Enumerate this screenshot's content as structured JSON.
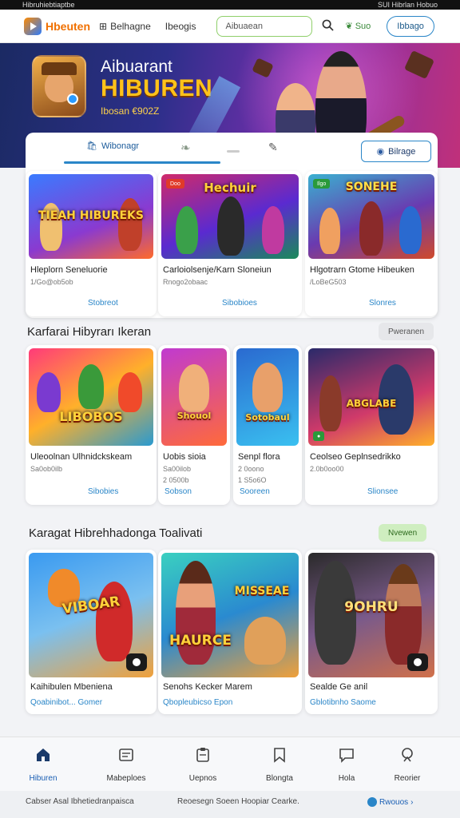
{
  "status_bar": {
    "left": "Hibruhiebtiaptbe",
    "right": "SUI Hibrlan Hobuo"
  },
  "header": {
    "logo_text": "Hbeuten",
    "nav": [
      {
        "label": "Belhagne",
        "icon": "grid-icon"
      },
      {
        "label": "Ibeogis"
      }
    ],
    "search_value": "Aibuaean",
    "language_label": "Suo",
    "action_button": "Ibbago"
  },
  "hero": {
    "subtitle": "Aibuarant",
    "title": "HIBUREN",
    "meta": "Ibosan €902Z"
  },
  "featured_panel": {
    "tabs": [
      {
        "label": "Wibonagr",
        "icon": "bag-icon"
      },
      {
        "label": "",
        "icon": "leaf-icon"
      },
      {
        "label": "",
        "icon": "note-icon"
      }
    ],
    "button_label": "Bilrage",
    "games": [
      {
        "art_text": "TIEAH HIBUREKS",
        "badge": "",
        "name": "Hleplorn Seneluorie",
        "meta": "1/Go@ob5ob",
        "tag": "Stobreot"
      },
      {
        "art_text": "Hechuir",
        "badge": "Doo",
        "name": "Carloiolsenje/Karn Sloneiun",
        "meta": "Rnogo2obaac",
        "tag": "Sibobioes"
      },
      {
        "art_text": "SONEHE",
        "badge": "Ilgo",
        "name": "Hlgotrarn Gtome Hibeuken",
        "meta": "/LoBeG503",
        "tag": "Slonres"
      }
    ]
  },
  "section_two": {
    "title": "Karfarai Hibyrarı Ikeran",
    "more": "Pweranen",
    "games": [
      {
        "art_text": "LIBOBOS",
        "name": "Uleoolnan Ulhnidckskeam",
        "meta": "Sa0ob0ilb",
        "meta2": "",
        "tag": "Sibobies"
      },
      {
        "art_text": "Shouol",
        "name": "Uobis sioia",
        "meta": "Sa00ilob",
        "meta2": "2 0500b",
        "tag": "Sobson"
      },
      {
        "art_text": "Sotobaul",
        "name": "Senpl flora",
        "meta": "2 0oono",
        "meta2": "1 S5o6O",
        "tag": "Sooreen"
      },
      {
        "art_text": "ABGLABE",
        "name": "Ceolseo Geplnsedrikko",
        "meta": "2.0b0oo00",
        "meta2": "",
        "tag": "Slionsee"
      }
    ]
  },
  "section_three": {
    "title": "Karagat Hibrehhadonga Toalivati",
    "more": "Nvewen",
    "games": [
      {
        "art_text": "VIBOAR",
        "name": "Kaihibulen Mbeniena",
        "tag": "Qoabinibot... Gomer"
      },
      {
        "art_text": "MISSEAE",
        "art_text2": "HAURCE",
        "name": "Senohs Kecker Marem",
        "tag": "Qbopleubicso Epon"
      },
      {
        "art_text": "9OHRU",
        "name": "Sealde Ge anil",
        "tag": "Gblotibnho Saome"
      }
    ]
  },
  "bottom_nav": [
    {
      "label": "Hiburen",
      "icon": "home-icon",
      "active": true
    },
    {
      "label": "Mabeploes",
      "icon": "catalog-icon"
    },
    {
      "label": "Uepnos",
      "icon": "clipboard-icon"
    },
    {
      "label": "Blongta",
      "icon": "bookmark-icon"
    },
    {
      "label": "Hola",
      "icon": "chat-icon"
    },
    {
      "label": "Reorier",
      "icon": "profile-icon"
    }
  ],
  "footer": {
    "left": "Cabser Asal Ibhetiedranpaisca",
    "center": "Reoesegn Soeen Hoopiar Cearke.",
    "right": "Rwouos"
  },
  "colors": {
    "accent": "#2a86c8",
    "brand_orange": "#f07000",
    "hero_gold": "#ffc21a",
    "active_nav": "#1a5fb4",
    "more_green": "#cfeec0"
  }
}
